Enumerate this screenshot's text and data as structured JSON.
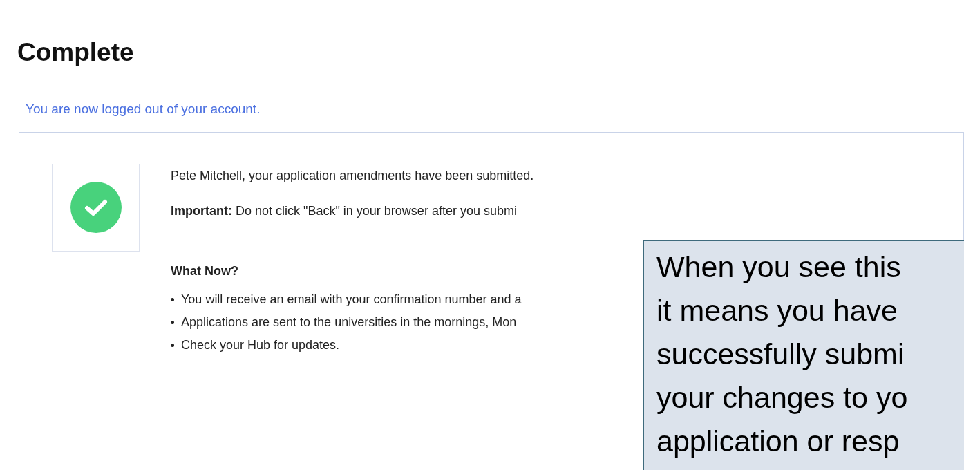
{
  "page": {
    "title": "Complete",
    "logout_notice": "You are now logged out of your account."
  },
  "confirmation": {
    "message": "Pete Mitchell, your application amendments have been submitted.",
    "warning": "**Important:** Do not click \"Back\" in your browser after you submi",
    "next_heading": "What Now?",
    "next_steps": [
      "You will receive an email with your confirmation number and a",
      "Applications are sent to the universities in the mornings, Mon",
      "Check your Hub for updates."
    ]
  },
  "callout": {
    "lines": [
      "When you see this",
      "it means you have",
      "successfully submi",
      "your changes to yo",
      "application or resp"
    ]
  }
}
